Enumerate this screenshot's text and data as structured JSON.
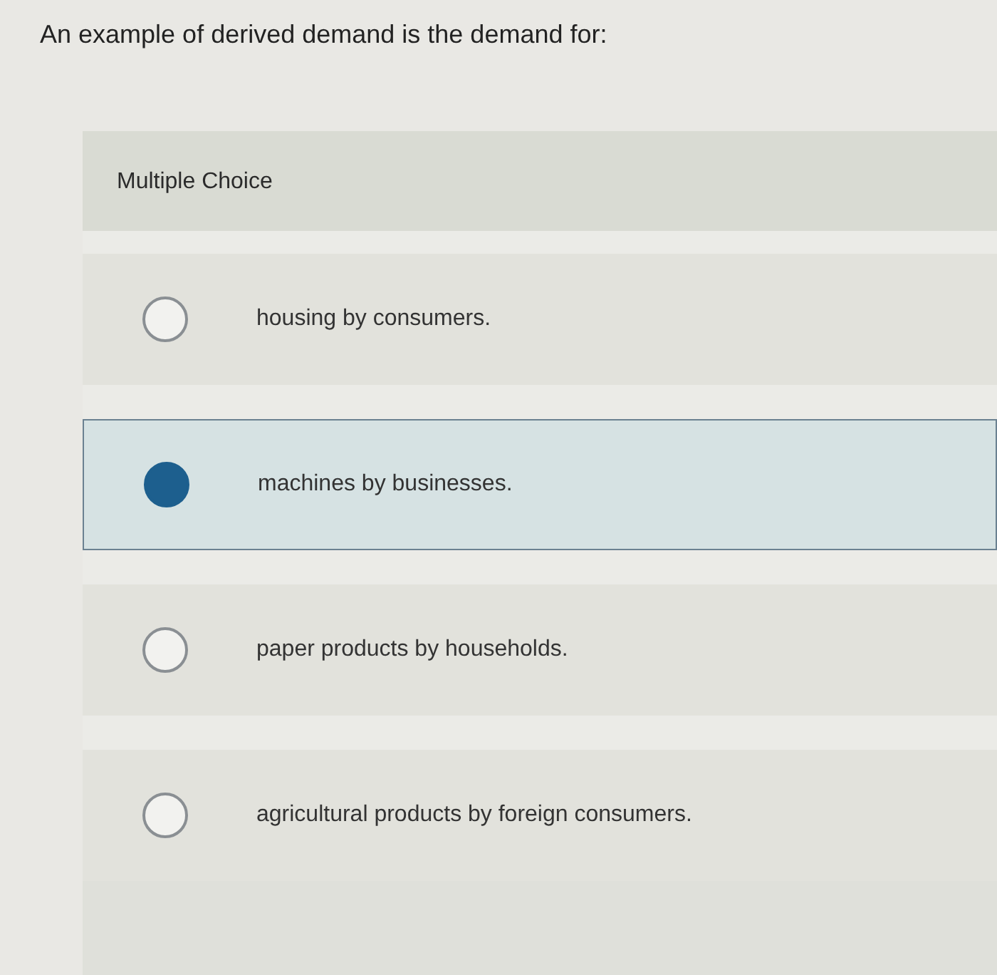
{
  "question": "An example of derived demand is the demand for:",
  "question_type": "Multiple Choice",
  "options": [
    {
      "label": "housing by consumers.",
      "selected": false
    },
    {
      "label": "machines by businesses.",
      "selected": true
    },
    {
      "label": "paper products by households.",
      "selected": false
    },
    {
      "label": "agricultural products by foreign consumers.",
      "selected": false
    }
  ]
}
